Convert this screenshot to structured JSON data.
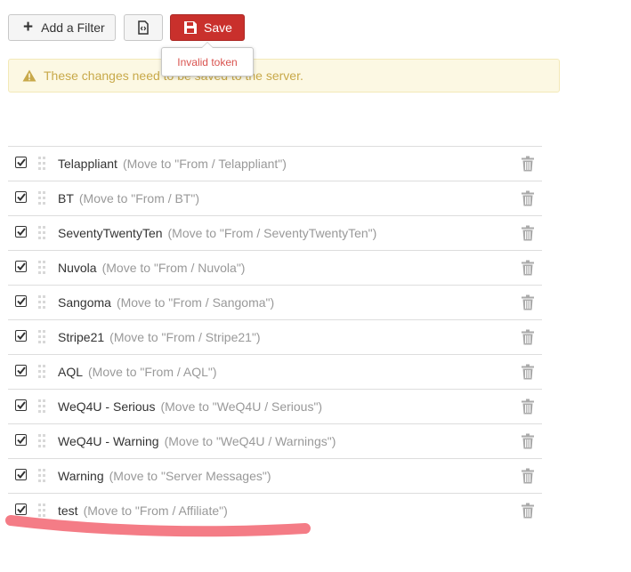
{
  "toolbar": {
    "add_filter_label": "Add a Filter",
    "code_icon": "code-file-icon",
    "save_label": "Save",
    "save_icon": "floppy-disk-icon"
  },
  "tooltip": {
    "text": "Invalid token"
  },
  "alert": {
    "icon": "warning-icon",
    "text": "These changes need to be saved to the server."
  },
  "filters": [
    {
      "name": "Telappliant",
      "action": "(Move to \"From / Telappliant\")",
      "checked": true
    },
    {
      "name": "BT",
      "action": "(Move to \"From / BT\")",
      "checked": true
    },
    {
      "name": "SeventyTwentyTen",
      "action": "(Move to \"From / SeventyTwentyTen\")",
      "checked": true
    },
    {
      "name": "Nuvola",
      "action": "(Move to \"From / Nuvola\")",
      "checked": true
    },
    {
      "name": "Sangoma",
      "action": "(Move to \"From / Sangoma\")",
      "checked": true
    },
    {
      "name": "Stripe21",
      "action": "(Move to \"From / Stripe21\")",
      "checked": true
    },
    {
      "name": "AQL",
      "action": "(Move to \"From / AQL\")",
      "checked": true
    },
    {
      "name": "WeQ4U - Serious",
      "action": "(Move to \"WeQ4U / Serious\")",
      "checked": true
    },
    {
      "name": "WeQ4U - Warning",
      "action": "(Move to \"WeQ4U / Warnings\")",
      "checked": true
    },
    {
      "name": "Warning",
      "action": "(Move to \"Server Messages\")",
      "checked": true
    },
    {
      "name": "test",
      "action": "(Move to \"From / Affiliate\")",
      "checked": true
    }
  ],
  "colors": {
    "danger": "#c9302c",
    "alert_bg": "#fcf8e3",
    "alert_text": "#c8a94a",
    "muted": "#999999",
    "annotation": "#f47c86"
  }
}
